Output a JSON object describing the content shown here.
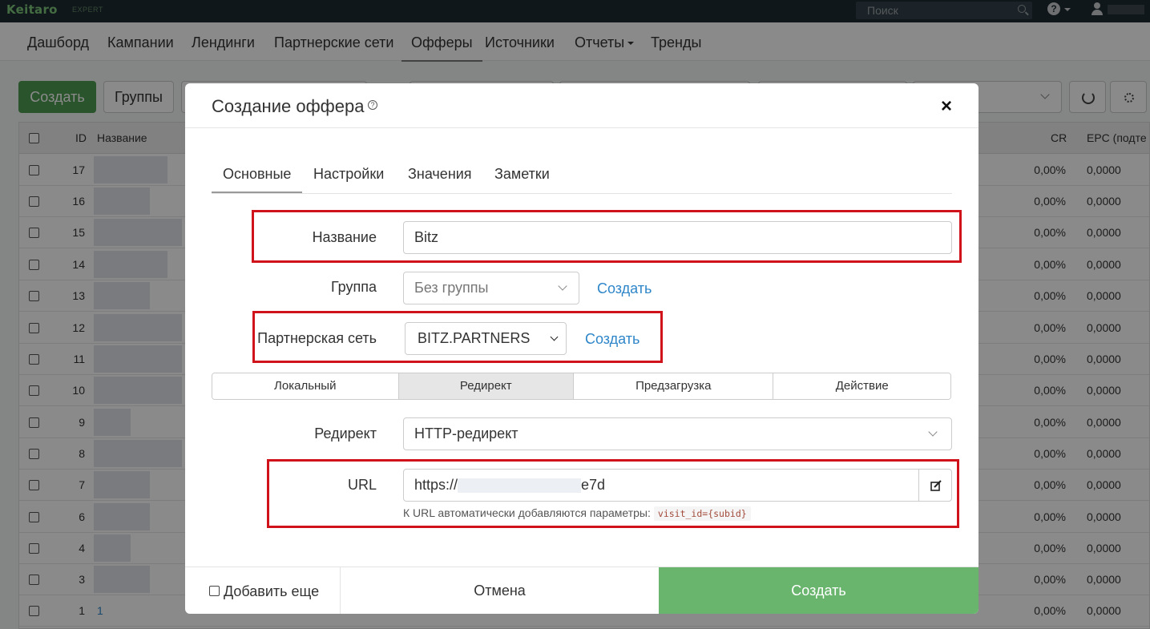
{
  "brand": {
    "name": "Keitaro",
    "edition": "EXPERT"
  },
  "topbar": {
    "search_placeholder": "Поиск"
  },
  "nav": [
    {
      "label": "Дашборд",
      "active": false
    },
    {
      "label": "Кампании",
      "active": false
    },
    {
      "label": "Лендинги",
      "active": false
    },
    {
      "label": "Партнерские сети",
      "active": false
    },
    {
      "label": "Офферы",
      "active": true
    },
    {
      "label": "Источники",
      "active": false
    },
    {
      "label": "Отчеты",
      "active": false,
      "dropdown": true
    },
    {
      "label": "Тренды",
      "active": false
    }
  ],
  "toolbar": {
    "create_label": "Создать",
    "groups_label": "Группы"
  },
  "table": {
    "headers": {
      "id": "ID",
      "name": "Название",
      "cr": "CR",
      "epc": "EPC (подте"
    },
    "rows": [
      {
        "id": "17",
        "cr": "0,00%",
        "epc": "0,0000"
      },
      {
        "id": "16",
        "cr": "0,00%",
        "epc": "0,0000"
      },
      {
        "id": "15",
        "cr": "0,00%",
        "epc": "0,0000"
      },
      {
        "id": "14",
        "cr": "0,00%",
        "epc": "0,0000"
      },
      {
        "id": "13",
        "cr": "0,00%",
        "epc": "0,0000"
      },
      {
        "id": "12",
        "cr": "0,00%",
        "epc": "0,0000"
      },
      {
        "id": "11",
        "cr": "0,00%",
        "epc": "0,0000"
      },
      {
        "id": "10",
        "cr": "0,00%",
        "epc": "0,0000"
      },
      {
        "id": "9",
        "cr": "0,00%",
        "epc": "0,0000"
      },
      {
        "id": "8",
        "cr": "0,00%",
        "epc": "0,0000"
      },
      {
        "id": "7",
        "cr": "0,00%",
        "epc": "0,0000"
      },
      {
        "id": "6",
        "cr": "0,00%",
        "epc": "0,0000"
      },
      {
        "id": "4",
        "cr": "0,00%",
        "epc": "0,0000"
      },
      {
        "id": "3",
        "cr": "0,00%",
        "epc": "0,0000"
      },
      {
        "id": "1",
        "name": "1",
        "cr": "0,00%",
        "epc": "0,0000"
      }
    ]
  },
  "modal": {
    "title": "Создание оффера",
    "close": "×",
    "tabs": [
      "Основные",
      "Настройки",
      "Значения",
      "Заметки"
    ],
    "name_label": "Название",
    "name_value": "Bitz",
    "group_label": "Группа",
    "group_value": "Без группы",
    "group_create_link": "Создать",
    "network_label": "Партнерская сеть",
    "network_value": "BITZ.PARTNERS",
    "network_create_link": "Создать",
    "type_tabs": [
      "Локальный",
      "Редирект",
      "Предзагрузка",
      "Действие"
    ],
    "type_active": "Редирект",
    "redirect_label": "Редирект",
    "redirect_value": "HTTP-редирект",
    "url_label": "URL",
    "url_prefix": "https://",
    "url_suffix": "e7d",
    "url_hint": "К URL автоматически добавляются параметры:",
    "url_hint_code": "visit_id={subid}",
    "add_more_label": "Добавить еще",
    "cancel_label": "Отмена",
    "submit_label": "Создать"
  },
  "colors": {
    "accent_green": "#6ab56e",
    "link_blue": "#2e86c9",
    "highlight_red": "#d0121b"
  }
}
